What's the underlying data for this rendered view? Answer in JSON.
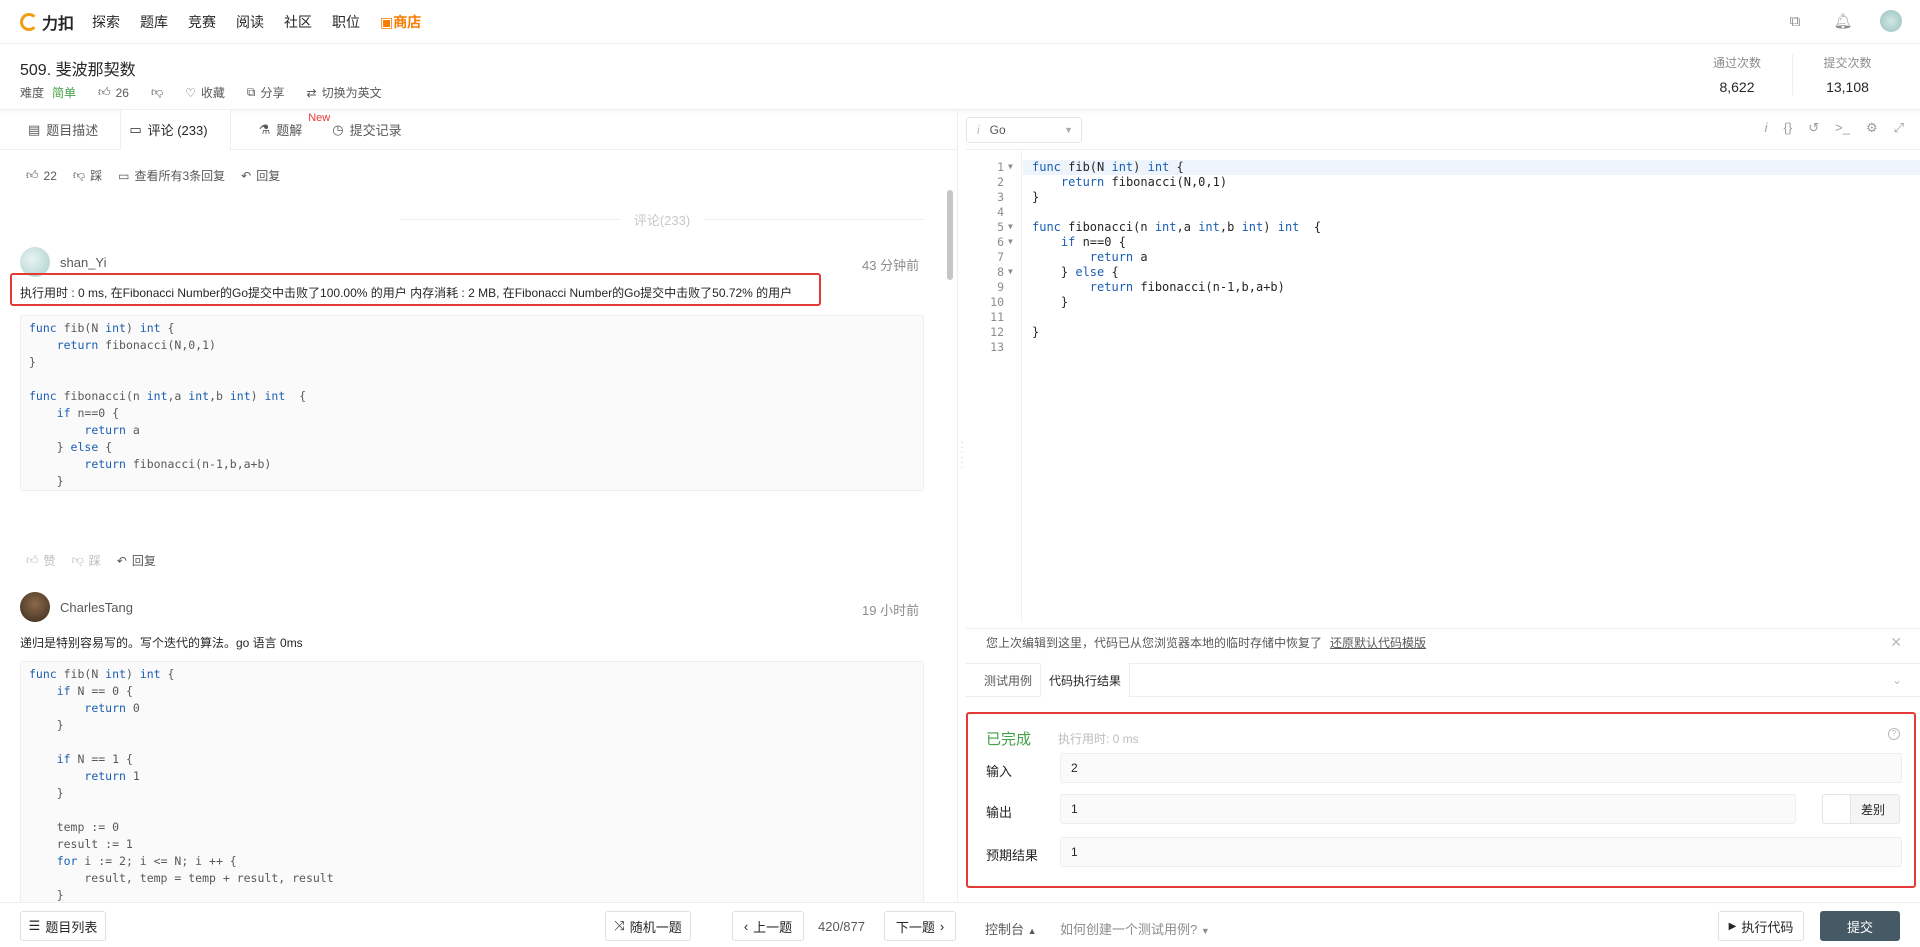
{
  "nav": {
    "logo": "力扣",
    "items": [
      "探索",
      "题库",
      "竞赛",
      "阅读",
      "社区",
      "职位"
    ],
    "shop": "商店"
  },
  "problem": {
    "title": "509. 斐波那契数",
    "difficulty_label": "难度",
    "difficulty": "简单",
    "likes": "26",
    "collect": "收藏",
    "share": "分享",
    "switch_lang": "切换为英文",
    "stats": [
      {
        "label": "通过次数",
        "value": "8,622"
      },
      {
        "label": "提交次数",
        "value": "13,108"
      }
    ]
  },
  "left_tabs": [
    {
      "label": "题目描述"
    },
    {
      "label": "评论 (233)"
    },
    {
      "label": "题解",
      "badge": "New"
    },
    {
      "label": "提交记录"
    }
  ],
  "top_actions": {
    "likes": "22",
    "dislike": "踩",
    "view_replies": "查看所有3条回复",
    "reply": "回复"
  },
  "comments_divider": "评论(233)",
  "comments": [
    {
      "user": "shan_Yi",
      "time": "43 分钟前",
      "text": "执行用时 : 0 ms, 在Fibonacci Number的Go提交中击败了100.00% 的用户 内存消耗 : 2 MB, 在Fibonacci Number的Go提交中击败了50.72% 的用户",
      "actions": {
        "like": "赞",
        "dislike": "踩",
        "reply": "回复"
      }
    },
    {
      "user": "CharlesTang",
      "time": "19 小时前",
      "text": "递归是特别容易写的。写个迭代的算法。go 语言 0ms"
    }
  ],
  "editor": {
    "language": "Go",
    "line_numbers": [
      "1",
      "2",
      "3",
      "4",
      "5",
      "6",
      "7",
      "8",
      "9",
      "10",
      "11",
      "12",
      "13"
    ]
  },
  "notice": {
    "text": "您上次编辑到这里，代码已从您浏览器本地的临时存储中恢复了",
    "link": "还原默认代码模版"
  },
  "result_tabs": [
    "测试用例",
    "代码执行结果"
  ],
  "result": {
    "status": "已完成",
    "time": "执行用时: 0 ms",
    "input_label": "输入",
    "input": "2",
    "output_label": "输出",
    "output": "1",
    "diff": "差别",
    "expected_label": "预期结果",
    "expected": "1"
  },
  "bottom": {
    "problem_list": "题目列表",
    "random": "随机一题",
    "prev": "上一题",
    "page": "420/877",
    "next": "下一题",
    "console": "控制台",
    "howto": "如何创建一个测试用例?",
    "run": "执行代码",
    "submit": "提交"
  }
}
